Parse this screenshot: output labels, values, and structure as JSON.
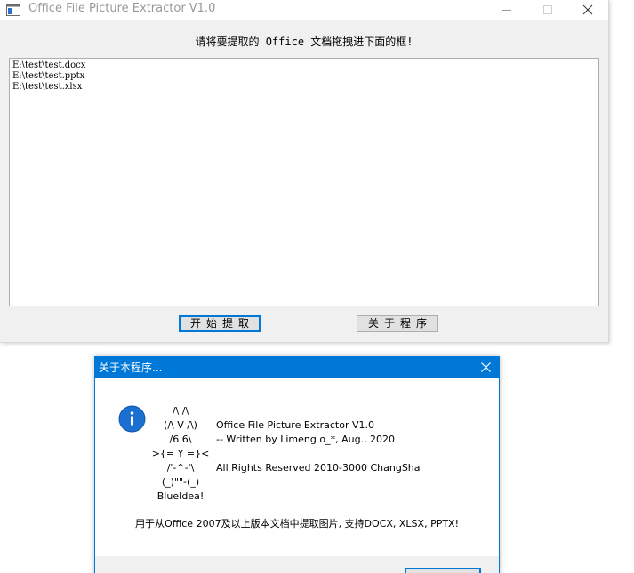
{
  "window": {
    "title": "Office File Picture Extractor V1.0"
  },
  "main": {
    "prompt": "请将要提取的 Office 文档拖拽进下面的框!",
    "files": [
      "E:\\test\\test.docx",
      "E:\\test\\test.pptx",
      "E:\\test\\test.xlsx"
    ],
    "start_button": "开始提取",
    "about_button": "关于程序"
  },
  "about_dialog": {
    "title": "关于本程序...",
    "ascii_art": [
      "/\\ /\\",
      "(/\\ V /\\)",
      "/6 6\\",
      ">{= Y =}<",
      "/'-^-'\\",
      "(_)\"\"-(_)",
      "BlueIdea!"
    ],
    "app_name": "Office File Picture Extractor V1.0",
    "author": "-- Written by Limeng o_*, Aug., 2020",
    "rights": "All Rights Reserved 2010-3000 ChangSha",
    "description": "用于从Office 2007及以上版本文档中提取图片, 支持DOCX, XLSX, PPTX!"
  },
  "colors": {
    "accent": "#0078d7",
    "window_bg": "#f0f0f0",
    "title_text": "#999999"
  },
  "icons": {
    "app": "app-window-icon",
    "info": "info-icon",
    "close": "close-icon",
    "minimize": "minimize-icon",
    "maximize": "maximize-icon"
  }
}
